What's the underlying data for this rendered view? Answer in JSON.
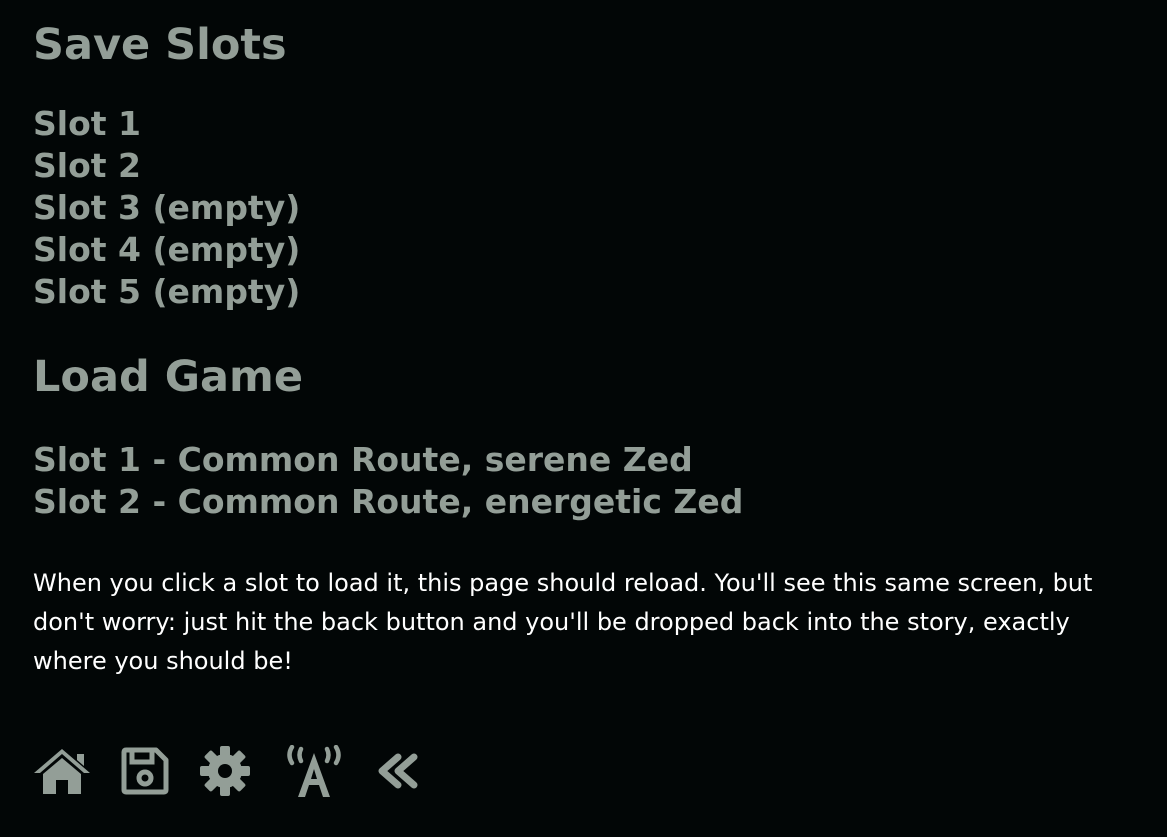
{
  "save": {
    "title": "Save Slots",
    "slots": [
      "Slot 1",
      "Slot 2",
      "Slot 3 (empty)",
      "Slot 4 (empty)",
      "Slot 5 (empty)"
    ]
  },
  "load": {
    "title": "Load Game",
    "slots": [
      "Slot 1 - Common Route, serene Zed",
      "Slot 2 - Common Route, energetic Zed"
    ],
    "note": "When you click a slot to load it, this page should reload. You'll see this same screen, but don't worry: just hit the back button and you'll be dropped back into the story, exactly where you should be!"
  },
  "toolbar": {
    "icons": [
      "home-icon",
      "save-icon",
      "settings-gear-icon",
      "accessibility-broadcast-icon",
      "back-chevrons-icon"
    ]
  },
  "colors": {
    "background": "#020606",
    "text": "#939e97",
    "note_text": "#ffffff"
  }
}
